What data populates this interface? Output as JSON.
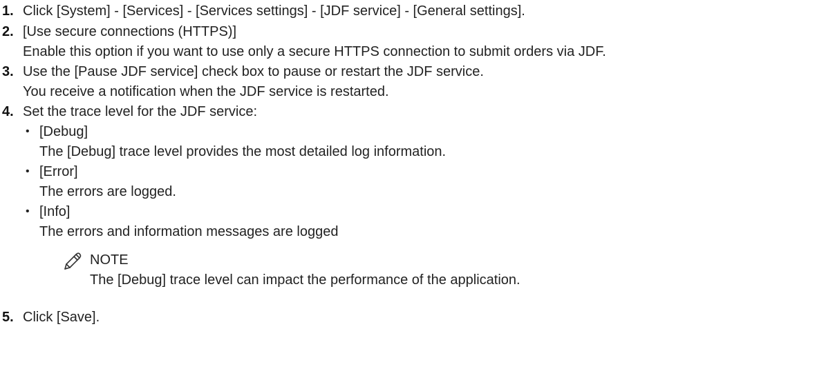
{
  "steps": [
    {
      "num": "1.",
      "text": "Click [System] - [Services] - [Services settings] - [JDF service] - [General settings]."
    },
    {
      "num": "2.",
      "text": "[Use secure connections (HTTPS)]",
      "detail": "Enable this option if you want to use only a secure HTTPS connection to submit orders via JDF."
    },
    {
      "num": "3.",
      "text": "Use the [Pause JDF service] check box to pause or restart the JDF service.",
      "detail": "You receive a notification when the JDF service is restarted."
    },
    {
      "num": "4.",
      "text": "Set the trace level for the JDF service:"
    },
    {
      "num": "5.",
      "text": "Click [Save]."
    }
  ],
  "trace_levels": [
    {
      "bullet": "•",
      "label": "[Debug]",
      "desc": "The [Debug] trace level provides the most detailed log information."
    },
    {
      "bullet": "•",
      "label": "[Error]",
      "desc": "The errors are logged."
    },
    {
      "bullet": "•",
      "label": "[Info]",
      "desc": "The errors and information messages are logged"
    }
  ],
  "note": {
    "icon": "pencil-icon",
    "label": "NOTE",
    "text": "The [Debug] trace level can impact the performance of the application."
  }
}
